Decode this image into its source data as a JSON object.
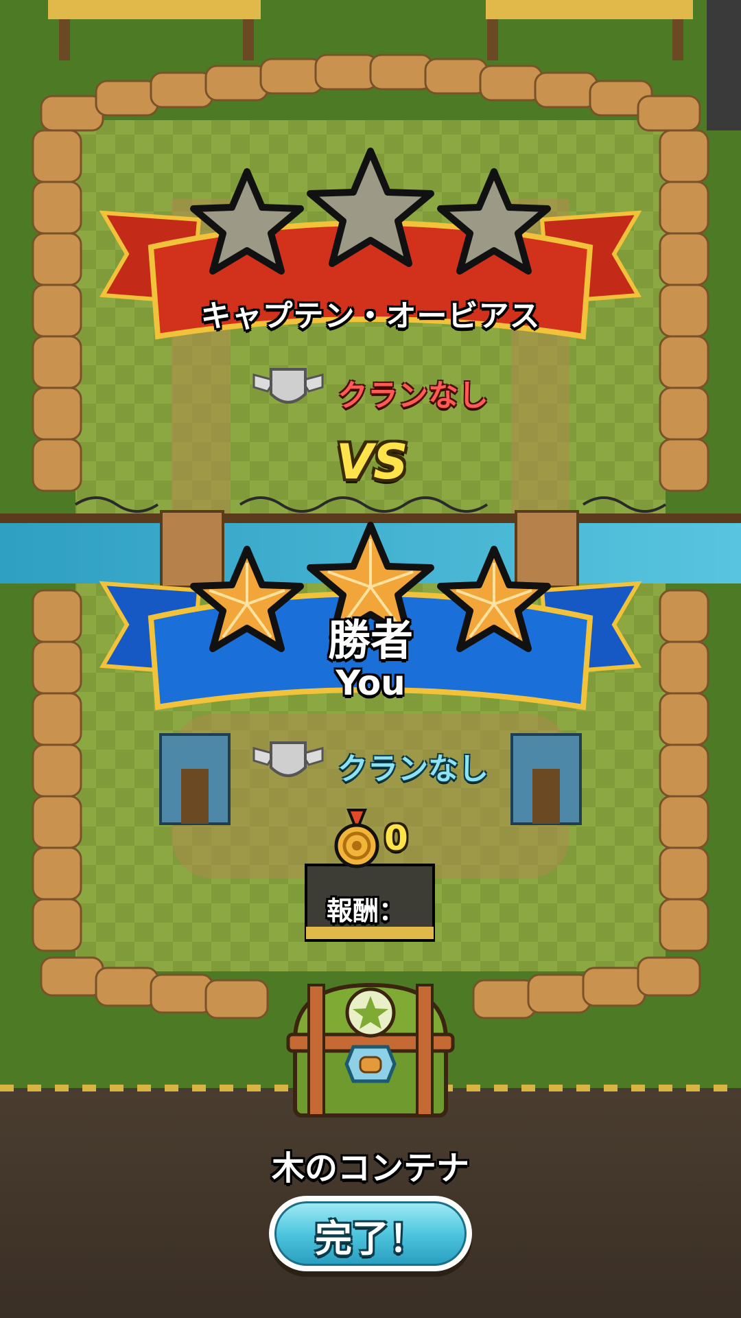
{
  "opponent": {
    "name": "キャプテン・オービアス",
    "clan": "クランなし",
    "stars_earned": 0,
    "stars_total": 3
  },
  "vs_label": "VS",
  "player": {
    "result_label": "勝者",
    "name": "You",
    "clan": "クランなし",
    "stars_earned": 3,
    "stars_total": 3
  },
  "reward": {
    "label": "報酬：",
    "medal_count": "0",
    "icon": "medal-icon"
  },
  "container": {
    "name": "木のコンテナ",
    "icon": "wooden-chest-icon"
  },
  "done_button": {
    "label": "完了！"
  },
  "colors": {
    "opponent_banner": "#d2321c",
    "player_banner": "#1a6fd8",
    "gold_star": "#f2a63a",
    "empty_star": "#9c9a86",
    "clan_red": "#ff5a55",
    "clan_blue": "#8ee3f2",
    "button": "#4fc6df"
  }
}
